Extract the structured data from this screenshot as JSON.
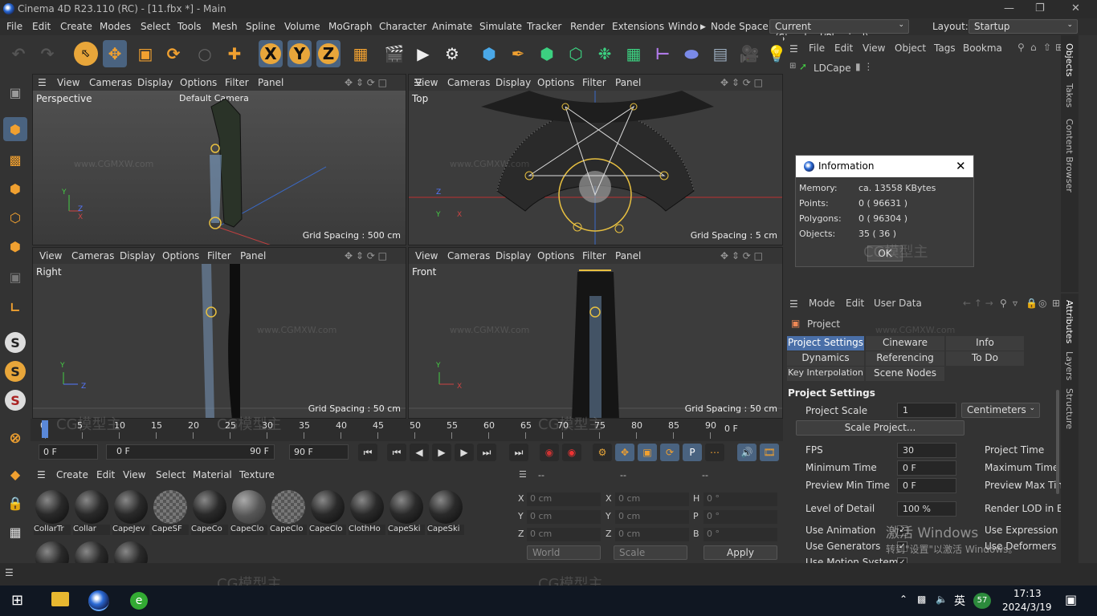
{
  "window": {
    "title": "Cinema 4D R23.110 (RC) - [11.fbx *] - Main"
  },
  "menu": [
    "File",
    "Edit",
    "Create",
    "Modes",
    "Select",
    "Tools",
    "Mesh",
    "Spline",
    "Volume",
    "MoGraph",
    "Character",
    "Animate",
    "Simulate",
    "Tracker",
    "Render",
    "Extensions",
    "Windo"
  ],
  "node_space": {
    "label": "Node Space:",
    "value": "Current (Standard/Physical)"
  },
  "layout": {
    "label": "Layout:",
    "value": "Startup"
  },
  "toolbar": {
    "x": "X",
    "y": "Y",
    "z": "Z"
  },
  "viewport_menu": [
    "View",
    "Cameras",
    "Display",
    "Options",
    "Filter",
    "Panel"
  ],
  "viewports": [
    {
      "name": "Perspective",
      "camera": "Default Camera",
      "grid": "Grid Spacing : 500 cm"
    },
    {
      "name": "Top",
      "grid": "Grid Spacing : 5 cm"
    },
    {
      "name": "Right",
      "grid": "Grid Spacing : 50 cm"
    },
    {
      "name": "Front",
      "grid": "Grid Spacing : 50 cm"
    }
  ],
  "axis_labels": {
    "x": "X",
    "y": "Y",
    "z": "Z"
  },
  "timeline": {
    "ticks": [
      "0",
      "5",
      "10",
      "15",
      "20",
      "25",
      "30",
      "35",
      "40",
      "45",
      "50",
      "55",
      "60",
      "65",
      "70",
      "75",
      "80",
      "85",
      "90"
    ],
    "end_label": "0 F",
    "current": 0,
    "start": 0,
    "end": 90
  },
  "transport": {
    "start_field": "0 F",
    "range_start": "0 F",
    "range_end": "90 F",
    "end_field": "90 F"
  },
  "material_menu": [
    "Create",
    "Edit",
    "View",
    "Select",
    "Material",
    "Texture"
  ],
  "materials": [
    {
      "name": "CollarTr",
      "kind": "solid"
    },
    {
      "name": "Collar",
      "kind": "solid"
    },
    {
      "name": "CapeJev",
      "kind": "solid"
    },
    {
      "name": "CapeSF",
      "kind": "checker"
    },
    {
      "name": "CapeCo",
      "kind": "solid"
    },
    {
      "name": "CapeClo",
      "kind": "glass"
    },
    {
      "name": "CapeClo",
      "kind": "checker"
    },
    {
      "name": "CapeClo",
      "kind": "solid"
    },
    {
      "name": "ClothHo",
      "kind": "solid"
    },
    {
      "name": "CapeSki",
      "kind": "solid"
    },
    {
      "name": "CapeSki",
      "kind": "solid"
    },
    {
      "name": "",
      "kind": "solid"
    },
    {
      "name": "",
      "kind": "solid"
    },
    {
      "name": "",
      "kind": "solid"
    }
  ],
  "coords": {
    "headers": [
      "--",
      "--",
      "--"
    ],
    "rows": [
      {
        "a": "X",
        "av": "0 cm",
        "b": "X",
        "bv": "0 cm",
        "c": "H",
        "cv": "0 °"
      },
      {
        "a": "Y",
        "av": "0 cm",
        "b": "Y",
        "bv": "0 cm",
        "c": "P",
        "cv": "0 °"
      },
      {
        "a": "Z",
        "av": "0 cm",
        "b": "Z",
        "bv": "0 cm",
        "c": "B",
        "cv": "0 °"
      }
    ],
    "world": "World",
    "scale": "Scale",
    "apply": "Apply"
  },
  "objects": {
    "menu": [
      "File",
      "Edit",
      "View",
      "Object",
      "Tags",
      "Bookma"
    ],
    "items": [
      {
        "name": "LDCape"
      }
    ]
  },
  "side_tabs_top": [
    "Objects",
    "Takes",
    "Content Browser"
  ],
  "side_tabs_bottom": [
    "Attributes",
    "Layers",
    "Structure"
  ],
  "dialog": {
    "title": "Information",
    "rows": [
      {
        "label": "Memory:",
        "value": "ca. 13558 KBytes"
      },
      {
        "label": "Points:",
        "value": "0 ( 96631 )"
      },
      {
        "label": "Polygons:",
        "value": "0 ( 96304 )"
      },
      {
        "label": "Objects:",
        "value": "35 ( 36 )"
      }
    ],
    "ok": "OK"
  },
  "attributes": {
    "menu": [
      "Mode",
      "Edit",
      "User Data"
    ],
    "object": "Project",
    "tabs": [
      [
        "Project Settings",
        "Cineware",
        "Info"
      ],
      [
        "Dynamics",
        "Referencing",
        "To Do"
      ],
      [
        "Key Interpolation",
        "Scene Nodes"
      ]
    ],
    "section": "Project Settings",
    "project_scale_label": "Project Scale",
    "project_scale_value": "1",
    "project_scale_unit": "Centimeters",
    "scale_project_button": "Scale Project...",
    "fields": [
      {
        "label": "FPS",
        "value": "30",
        "right": "Project Time"
      },
      {
        "label": "Minimum Time",
        "value": "0 F",
        "right": "Maximum Time"
      },
      {
        "label": "Preview Min Time",
        "value": "0 F",
        "right": "Preview Max Time"
      },
      {
        "label": "Level of Detail",
        "value": "100 %",
        "right": "Render LOD in Edit"
      }
    ],
    "checks": [
      {
        "label": "Use Animation",
        "right": "Use Expression"
      },
      {
        "label": "Use Generators",
        "right": "Use Deformers"
      },
      {
        "label": "Use Motion System",
        "right": ""
      }
    ],
    "check_mark": "✓"
  },
  "activation": {
    "line1": "激活 Windows",
    "line2": "转到\"设置\"以激活 Windows。"
  },
  "watermarks": [
    "www.CGMXW.com",
    "CG模型主"
  ],
  "taskbar": {
    "time": "17:13",
    "date": "2024/3/19",
    "lang": "英",
    "badge": "57"
  }
}
